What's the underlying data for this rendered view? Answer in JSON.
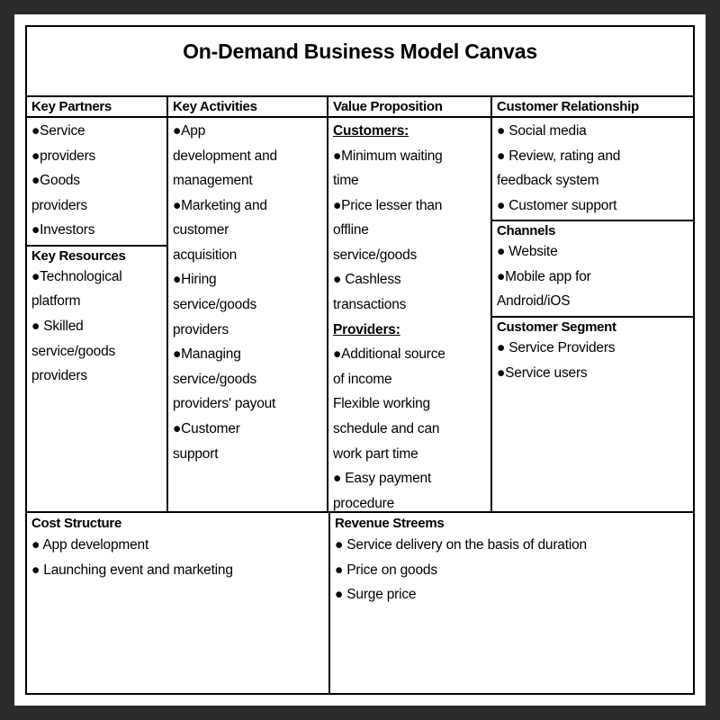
{
  "title": "On-Demand Business Model Canvas",
  "blocks": {
    "key_partners": {
      "heading": "Key Partners",
      "items": [
        "●Service",
        "●providers",
        "●Goods",
        "providers",
        "●Investors"
      ]
    },
    "key_resources": {
      "heading": "Key Resources",
      "items": [
        "●Technological",
        "platform",
        "● Skilled",
        "service/goods",
        "providers"
      ]
    },
    "key_activities": {
      "heading": "Key Activities",
      "items": [
        "●App",
        "development and",
        "management",
        "●Marketing and",
        "customer",
        "acquisition",
        "●Hiring",
        "service/goods",
        "providers",
        "●Managing",
        "service/goods",
        "providers' payout",
        "●Customer",
        "support"
      ]
    },
    "value_proposition": {
      "heading": "Value Proposition",
      "subheading_customers": "Customers:",
      "customer_items": [
        "●Minimum waiting",
        "time",
        "●Price lesser than",
        "offline",
        "service/goods",
        "● Cashless",
        "transactions"
      ],
      "subheading_providers": "Providers:",
      "provider_items": [
        "●Additional source",
        "of income",
        "Flexible working",
        "schedule and can",
        "work part time",
        "● Easy payment",
        "procedure"
      ]
    },
    "customer_relationship": {
      "heading": "Customer Relationship",
      "items": [
        "● Social media",
        "● Review, rating and",
        "feedback system",
        "● Customer support"
      ]
    },
    "channels": {
      "heading": "Channels",
      "items": [
        "● Website",
        "●Mobile app for",
        "Android/iOS"
      ]
    },
    "customer_segment": {
      "heading": "Customer Segment",
      "items": [
        "● Service Providers",
        "●Service users"
      ]
    },
    "cost_structure": {
      "heading": "Cost Structure",
      "items": [
        "● App development",
        "● Launching event and marketing"
      ]
    },
    "revenue_streams": {
      "heading": "Revenue Streems",
      "items": [
        "● Service delivery on the basis of duration",
        "● Price on goods",
        "● Surge price"
      ]
    }
  }
}
